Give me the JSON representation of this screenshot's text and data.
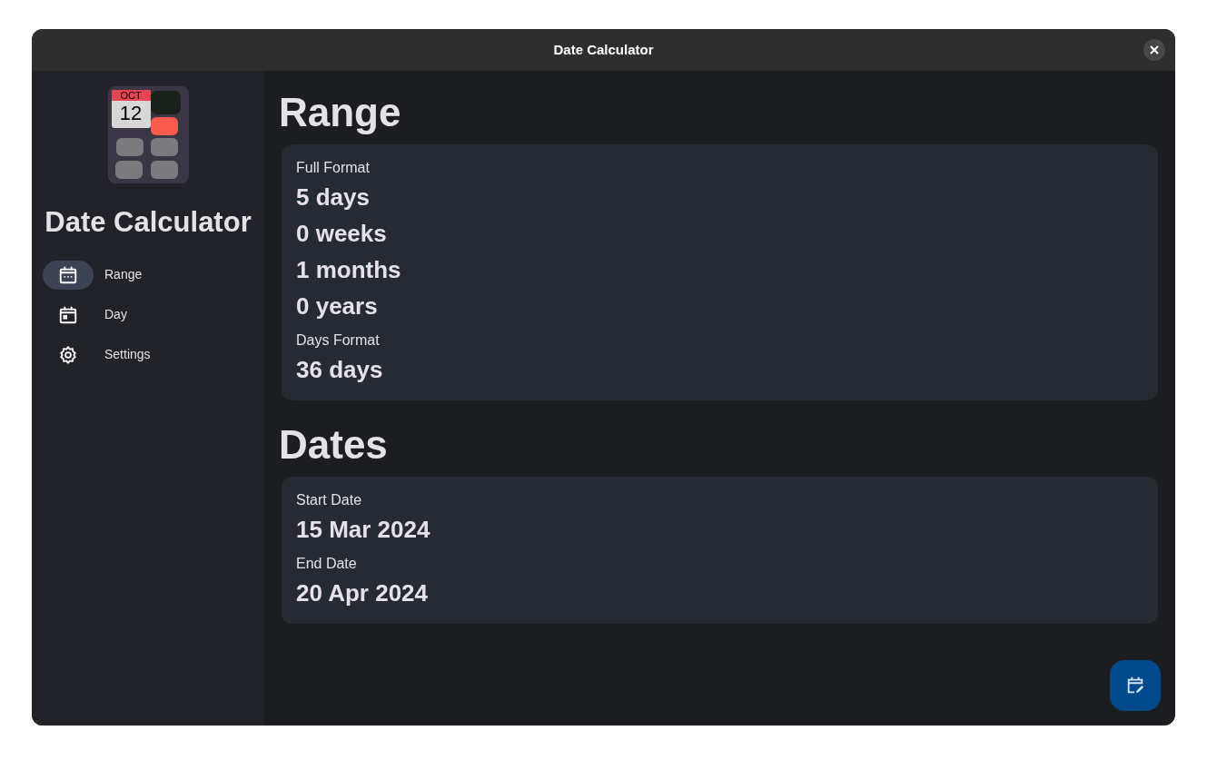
{
  "window": {
    "title": "Date Calculator"
  },
  "sidebar": {
    "logo": {
      "month": "OCT",
      "day": "12"
    },
    "app_name": "Date Calculator",
    "items": [
      {
        "label": "Range",
        "kind": "range",
        "selected": true
      },
      {
        "label": "Day",
        "kind": "day",
        "selected": false
      },
      {
        "label": "Settings",
        "kind": "settings",
        "selected": false
      }
    ]
  },
  "sections": [
    {
      "title": "Range",
      "fields": [
        {
          "label": "Full Format",
          "values": [
            "5 days",
            "0 weeks",
            "1 months",
            "0 years"
          ]
        },
        {
          "label": "Days Format",
          "values": [
            "36 days"
          ]
        }
      ]
    },
    {
      "title": "Dates",
      "fields": [
        {
          "label": "Start Date",
          "values": [
            "15 Mar 2024"
          ]
        },
        {
          "label": "End Date",
          "values": [
            "20 Apr 2024"
          ]
        }
      ]
    }
  ]
}
